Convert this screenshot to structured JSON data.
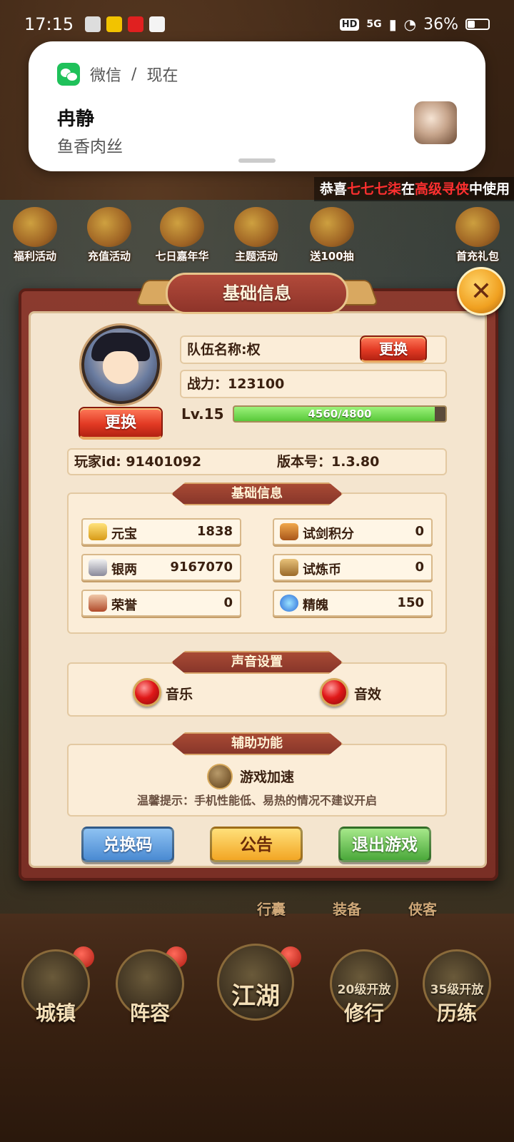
{
  "status_bar": {
    "time": "17:15",
    "network": "5G",
    "hd": "HD",
    "battery": "36%"
  },
  "notification": {
    "app": "微信",
    "separator": "/",
    "when": "现在",
    "sender": "冉静",
    "message": "鱼香肉丝"
  },
  "marquee": {
    "prefix": "恭喜",
    "player": "七七七柒",
    "mid": "在",
    "event": "高级寻侠",
    "suffix": "中使用"
  },
  "events": [
    "福利活动",
    "充值活动",
    "七日嘉年华",
    "主题活动",
    "送100抽",
    "首充礼包"
  ],
  "panel": {
    "title": "基础信息",
    "team_name": "队伍名称:权",
    "change_team": "更换",
    "power": "战力：123100",
    "change_avatar": "更换",
    "level": "Lv.15",
    "exp_text": "4560/4800",
    "exp_current": 4560,
    "exp_max": 4800,
    "player_id": "玩家id: 91401092",
    "version": "版本号：1.3.80"
  },
  "basic_section": {
    "header": "基础信息",
    "resources": [
      {
        "name": "元宝",
        "value": "1838",
        "icon": "gold-ingot-icon"
      },
      {
        "name": "试剑积分",
        "value": "0",
        "icon": "sword-trial-icon"
      },
      {
        "name": "银两",
        "value": "9167070",
        "icon": "silver-ingot-icon"
      },
      {
        "name": "试炼币",
        "value": "0",
        "icon": "trial-coin-icon"
      },
      {
        "name": "荣誉",
        "value": "0",
        "icon": "honor-icon"
      },
      {
        "name": "精魄",
        "value": "150",
        "icon": "spirit-icon"
      }
    ]
  },
  "sound_section": {
    "header": "声音设置",
    "music": "音乐",
    "sfx": "音效"
  },
  "aux_section": {
    "header": "辅助功能",
    "accel": "游戏加速",
    "tip": "温馨提示：手机性能低、易热的情况不建议开启"
  },
  "buttons": {
    "redeem": "兑换码",
    "notice": "公告",
    "exit": "退出游戏"
  },
  "mid_labels": [
    "行囊",
    "装备",
    "侠客"
  ],
  "nav": {
    "town": "城镇",
    "lineup": "阵容",
    "jianghu": "江湖",
    "cultivate": "修行",
    "cultivate_lock": "20级开放",
    "train": "历练",
    "train_lock": "35级开放"
  }
}
